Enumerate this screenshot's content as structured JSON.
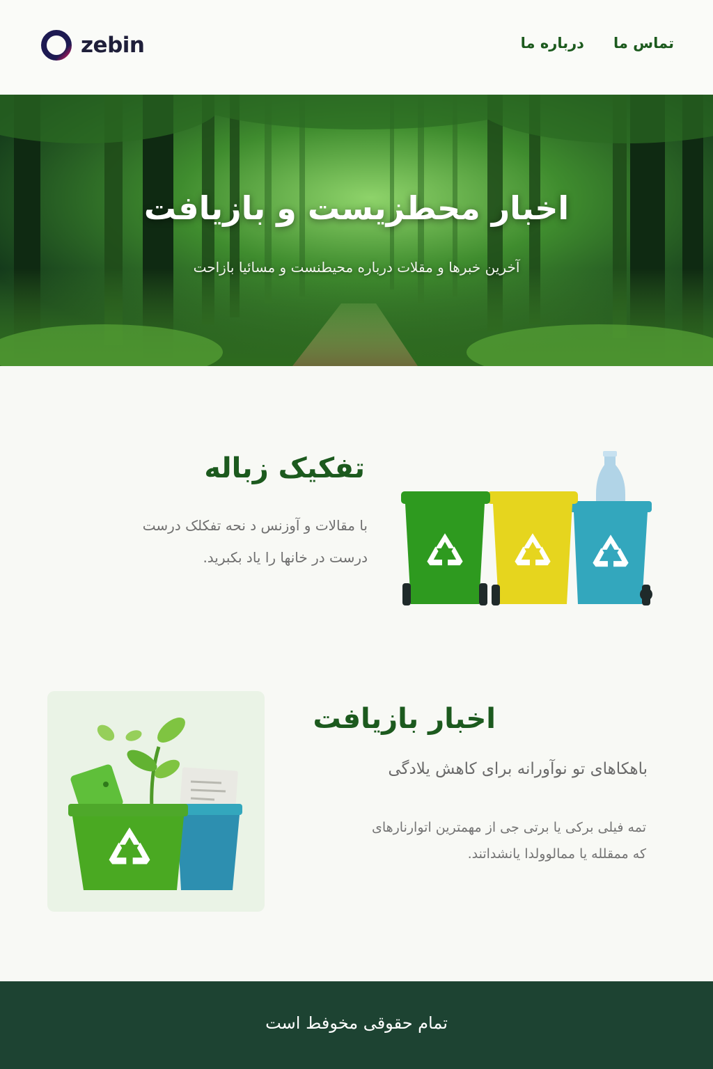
{
  "header": {
    "logo_text": "zebin",
    "nav": {
      "contact": "تماس ما",
      "about": "درباره ما"
    }
  },
  "hero": {
    "title": "اخبار محطزیست و بازیافت",
    "subtitle": "آخرین خبرها و مقلات درباره محیطنست و مسائیا بازاحت"
  },
  "section_sorting": {
    "title": "تفکیک زباله",
    "body_line1": "با مقالات و آوزنس د نحه تفکلک درست",
    "body_line2": "درست در خانها را یاد بکبرید.",
    "bin_colors": [
      "#2e9a1f",
      "#e6d51e",
      "#33a7bd"
    ],
    "bins_icon": "recycling-bins-icon"
  },
  "section_news": {
    "title": "اخبار بازیافت",
    "subtitle": "باهکاهای تو نوآورانه برای کاهش یلادگی",
    "body_line1": "تمه فیلی برکی یا برتی جی از مهمترین اتوارنارهای",
    "body_line2": "که ممقلله یا ممالوولدا یانشداتند.",
    "illustration_icon": "recycle-bin-plant-icon"
  },
  "footer": {
    "copyright": "تمام حقوقی مخوفط است"
  },
  "colors": {
    "brand_green": "#1c5a1e",
    "footer_bg": "#1d4332",
    "page_bg": "#f8f9f5"
  }
}
